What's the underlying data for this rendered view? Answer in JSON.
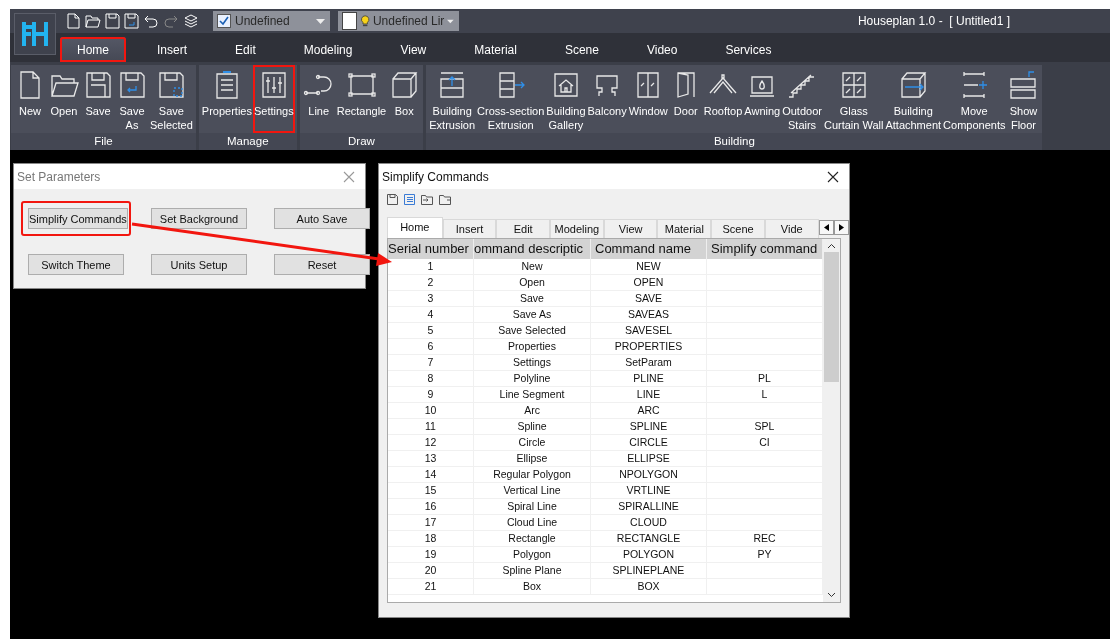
{
  "title_bar": {
    "layer_combo": {
      "checked": true,
      "value": "Undefined"
    },
    "linetype_combo": {
      "value": "Undefined Lir"
    },
    "title": "Houseplan 1.0 -  [ Untitled1 ]"
  },
  "tabs": [
    {
      "label": "Home",
      "selected": true,
      "highlighted": true
    },
    {
      "label": "Insert",
      "selected": false,
      "highlighted": false
    },
    {
      "label": "Edit",
      "selected": false,
      "highlighted": false
    },
    {
      "label": "Modeling",
      "selected": false,
      "highlighted": false
    },
    {
      "label": "View",
      "selected": false,
      "highlighted": false
    },
    {
      "label": "Material",
      "selected": false,
      "highlighted": false
    },
    {
      "label": "Scene",
      "selected": false,
      "highlighted": false
    },
    {
      "label": "Video",
      "selected": false,
      "highlighted": false
    },
    {
      "label": "Services",
      "selected": false,
      "highlighted": false
    }
  ],
  "ribbon_groups": [
    {
      "label": "File",
      "items": [
        {
          "label": "New",
          "highlighted": false
        },
        {
          "label": "Open",
          "highlighted": false
        },
        {
          "label": "Save",
          "highlighted": false
        },
        {
          "label": "Save\nAs",
          "highlighted": false
        },
        {
          "label": "Save\nSelected",
          "highlighted": false
        }
      ]
    },
    {
      "label": "Manage",
      "items": [
        {
          "label": "Properties",
          "highlighted": false
        },
        {
          "label": "Settings",
          "highlighted": true
        }
      ]
    },
    {
      "label": "Draw",
      "items": [
        {
          "label": "Line",
          "highlighted": false
        },
        {
          "label": "Rectangle",
          "highlighted": false
        },
        {
          "label": "Box",
          "highlighted": false
        }
      ]
    },
    {
      "label": "Building",
      "items": [
        {
          "label": "Building\nExtrusion",
          "highlighted": false
        },
        {
          "label": "Cross-section\nExtrusion",
          "highlighted": false
        },
        {
          "label": "Building\nGallery",
          "highlighted": false
        },
        {
          "label": "Balcony",
          "highlighted": false
        },
        {
          "label": "Window",
          "highlighted": false
        },
        {
          "label": "Door",
          "highlighted": false
        },
        {
          "label": "Rooftop",
          "highlighted": false
        },
        {
          "label": "Awning",
          "highlighted": false
        },
        {
          "label": "Outdoor\nStairs",
          "highlighted": false
        },
        {
          "label": "Glass\nCurtain Wall",
          "highlighted": false
        },
        {
          "label": "Building\nAttachment",
          "highlighted": false
        },
        {
          "label": "Move\nComponents",
          "highlighted": false
        },
        {
          "label": "Show\nFloor",
          "highlighted": false
        }
      ]
    }
  ],
  "set_parameters": {
    "title": "Set Parameters",
    "buttons": [
      {
        "label": "Simplify Commands",
        "highlighted": true
      },
      {
        "label": "Set Background",
        "highlighted": false
      },
      {
        "label": "Auto Save",
        "highlighted": false
      },
      {
        "label": "Switch Theme",
        "highlighted": false
      },
      {
        "label": "Units Setup",
        "highlighted": false
      },
      {
        "label": "Reset",
        "highlighted": false
      }
    ]
  },
  "simplify_commands": {
    "title": "Simplify Commands",
    "tabs": [
      {
        "label": "Home",
        "selected": true
      },
      {
        "label": "Insert",
        "selected": false
      },
      {
        "label": "Edit",
        "selected": false
      },
      {
        "label": "Modeling",
        "selected": false
      },
      {
        "label": "View",
        "selected": false
      },
      {
        "label": "Material",
        "selected": false
      },
      {
        "label": "Scene",
        "selected": false
      },
      {
        "label": "Vide",
        "selected": false
      }
    ],
    "table": {
      "columns": [
        "Serial number",
        "ommand descriptic",
        "Command name",
        "Simplify command"
      ],
      "rows": [
        [
          "1",
          "New",
          "NEW",
          ""
        ],
        [
          "2",
          "Open",
          "OPEN",
          ""
        ],
        [
          "3",
          "Save",
          "SAVE",
          ""
        ],
        [
          "4",
          "Save As",
          "SAVEAS",
          ""
        ],
        [
          "5",
          "Save Selected",
          "SAVESEL",
          ""
        ],
        [
          "6",
          "Properties",
          "PROPERTIES",
          ""
        ],
        [
          "7",
          "Settings",
          "SetParam",
          ""
        ],
        [
          "8",
          "Polyline",
          "PLINE",
          "PL"
        ],
        [
          "9",
          "Line Segment",
          "LINE",
          "L"
        ],
        [
          "10",
          "Arc",
          "ARC",
          ""
        ],
        [
          "11",
          "Spline",
          "SPLINE",
          "SPL"
        ],
        [
          "12",
          "Circle",
          "CIRCLE",
          "CI"
        ],
        [
          "13",
          "Ellipse",
          "ELLIPSE",
          ""
        ],
        [
          "14",
          "Regular Polygon",
          "NPOLYGON",
          ""
        ],
        [
          "15",
          "Vertical Line",
          "VRTLINE",
          ""
        ],
        [
          "16",
          "Spiral Line",
          "SPIRALLINE",
          ""
        ],
        [
          "17",
          "Cloud Line",
          "CLOUD",
          ""
        ],
        [
          "18",
          "Rectangle",
          "RECTANGLE",
          "REC"
        ],
        [
          "19",
          "Polygon",
          "POLYGON",
          "PY"
        ],
        [
          "20",
          "Spline Plane",
          "SPLINEPLANE",
          ""
        ],
        [
          "21",
          "Box",
          "BOX",
          ""
        ]
      ]
    }
  }
}
